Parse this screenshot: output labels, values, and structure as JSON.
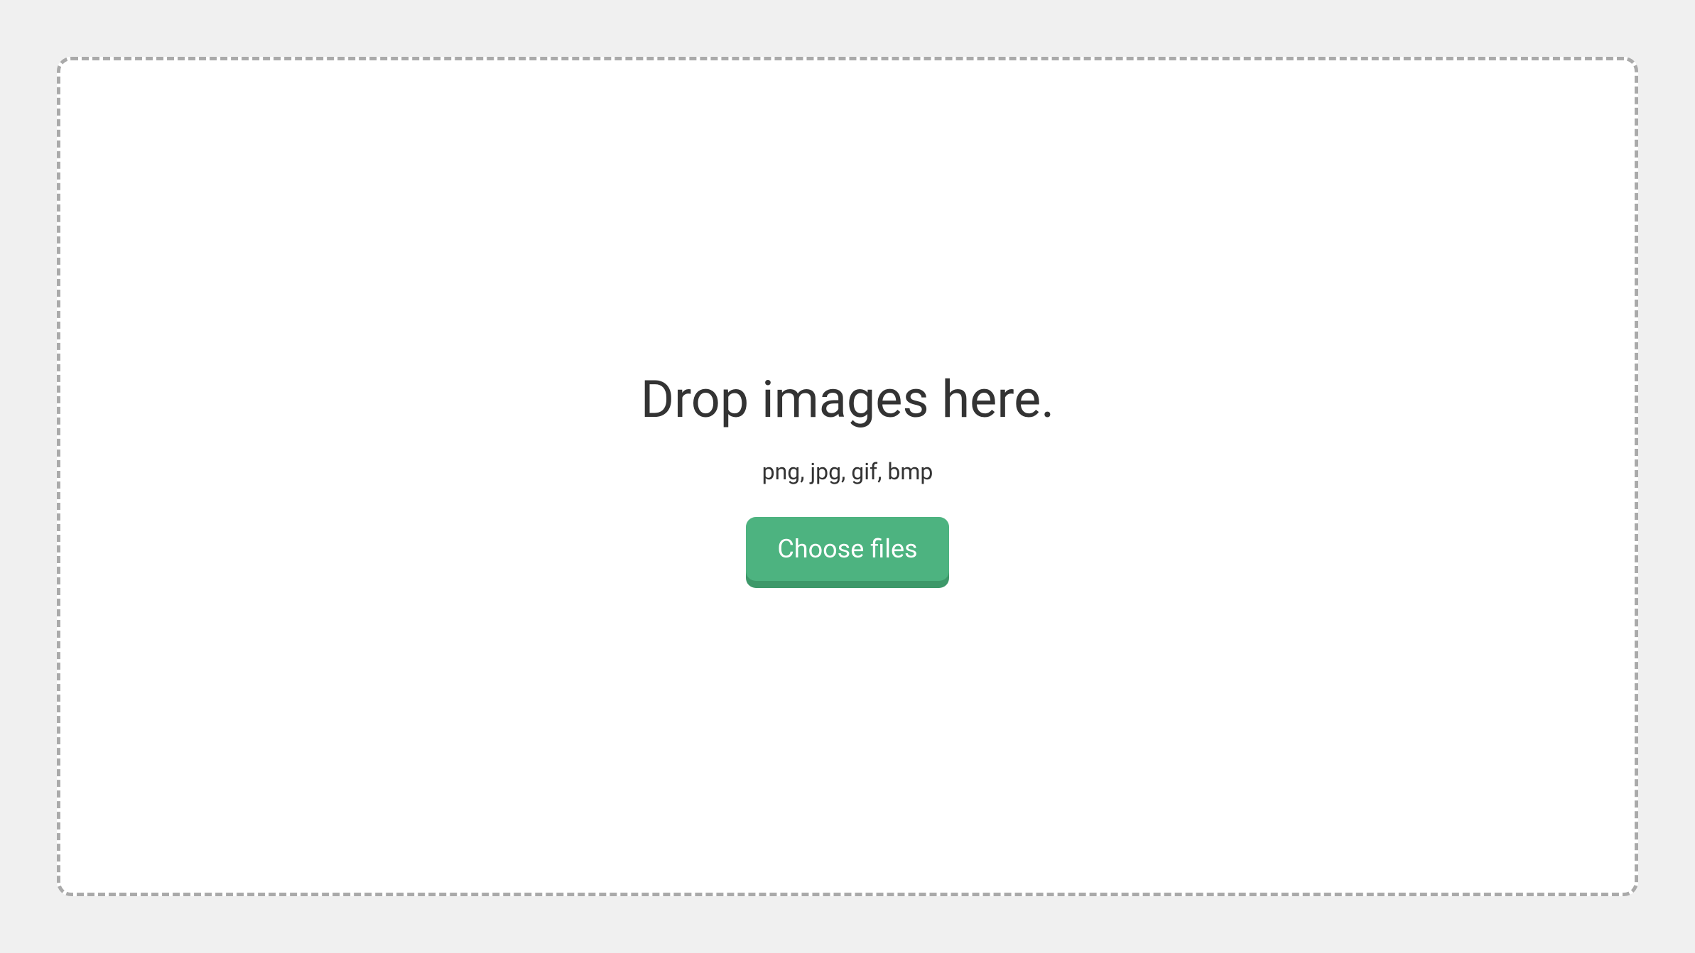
{
  "dropzone": {
    "title": "Drop images here.",
    "file_types": "png, jpg, gif, bmp",
    "button_label": "Choose files"
  }
}
